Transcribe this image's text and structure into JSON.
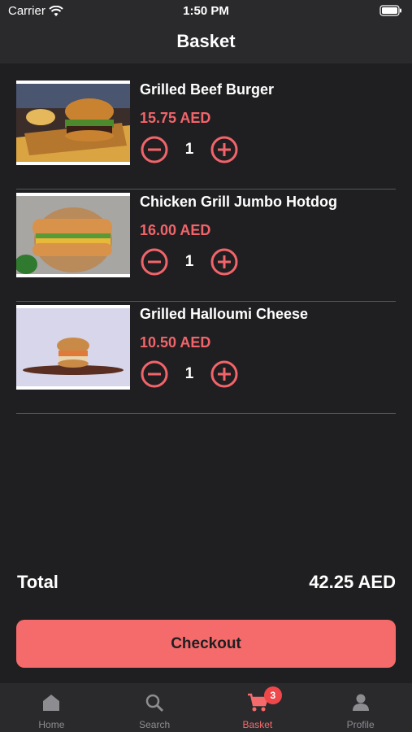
{
  "status_bar": {
    "carrier": "Carrier",
    "time": "1:50 PM"
  },
  "header": {
    "title": "Basket"
  },
  "items": [
    {
      "name": "Grilled Beef Burger",
      "price": "15.75 AED",
      "quantity": "1"
    },
    {
      "name": "Chicken Grill Jumbo Hotdog",
      "price": "16.00 AED",
      "quantity": "1"
    },
    {
      "name": "Grilled Halloumi Cheese",
      "price": "10.50 AED",
      "quantity": "1"
    }
  ],
  "total": {
    "label": "Total",
    "value": "42.25 AED"
  },
  "checkout": {
    "label": "Checkout"
  },
  "tabbar": {
    "tabs": [
      {
        "label": "Home",
        "icon": "home-icon"
      },
      {
        "label": "Search",
        "icon": "search-icon"
      },
      {
        "label": "Basket",
        "icon": "cart-icon",
        "badge": "3",
        "active": true
      },
      {
        "label": "Profile",
        "icon": "profile-icon"
      }
    ]
  },
  "colors": {
    "accent": "#f56b6b",
    "background": "#1f1f21",
    "bar": "#2a2a2d"
  }
}
